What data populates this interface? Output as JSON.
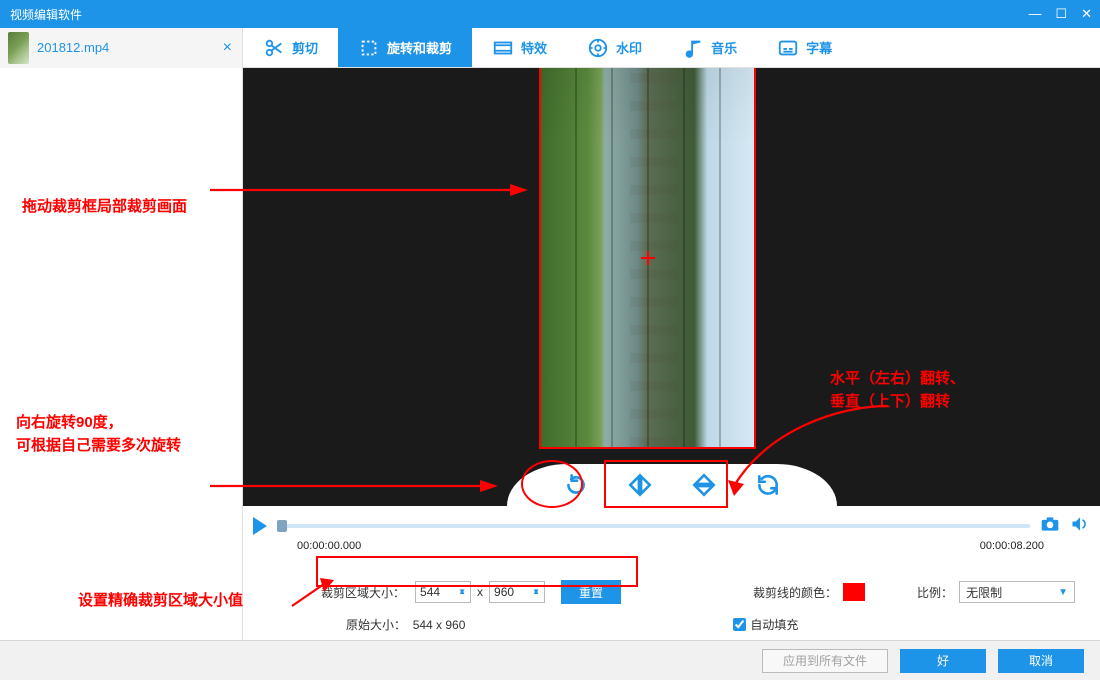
{
  "window": {
    "title": "视频编辑软件"
  },
  "file_tab": {
    "name": "201812.mp4"
  },
  "tabs": {
    "cut": "剪切",
    "rotate_crop": "旋转和裁剪",
    "effects": "特效",
    "watermark": "水印",
    "music": "音乐",
    "subtitle": "字幕"
  },
  "player": {
    "time_start": "00:00:00.000",
    "time_end": "00:00:08.200"
  },
  "crop": {
    "size_label": "裁剪区域大小：",
    "w": "544",
    "h": "960",
    "x": "x",
    "reset": "重置",
    "orig_label": "原始大小：",
    "orig_value": "544 x 960",
    "line_color_label": "裁剪线的颜色：",
    "ratio_label": "比例：",
    "ratio_value": "无限制",
    "autofill": "自动填充"
  },
  "footer": {
    "apply_all": "应用到所有文件",
    "ok": "好",
    "cancel": "取消"
  },
  "annotations": {
    "drag_crop": "拖动裁剪框局部裁剪画面",
    "rotate_right": "向右旋转90度，\n可根据自己需要多次旋转",
    "flip": "水平（左右）翻转、\n垂直（上下）翻转",
    "precise_size": "设置精确裁剪区域大小值"
  },
  "icons": {
    "minimize": "—",
    "maximize": "☐",
    "close": "✕",
    "file_close": "×"
  }
}
